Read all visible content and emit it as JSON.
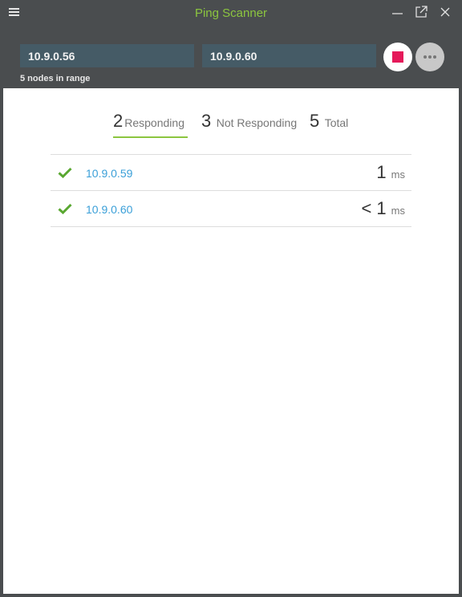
{
  "window": {
    "title": "Ping Scanner"
  },
  "scan": {
    "start_ip": "10.9.0.56",
    "end_ip": "10.9.0.60",
    "range_info": "5 nodes in range"
  },
  "tabs": [
    {
      "count": "2",
      "label": "Responding"
    },
    {
      "count": "3",
      "label": "Not Responding"
    },
    {
      "count": "5",
      "label": "Total"
    }
  ],
  "results": [
    {
      "ip": "10.9.0.59",
      "latency": "1",
      "unit": "ms"
    },
    {
      "ip": "10.9.0.60",
      "latency": "< 1",
      "unit": "ms"
    }
  ],
  "colors": {
    "accent": "#8cc63f",
    "stop": "#e5195a",
    "link": "#3a9fd8",
    "header_bg": "#4a4d4f",
    "field_bg": "#455b66"
  },
  "icons": {
    "menu": "hamburger-icon",
    "minimize": "minimize-icon",
    "popout": "popout-icon",
    "close": "close-icon",
    "stop": "stop-icon",
    "more": "more-icon",
    "status": "check-icon"
  }
}
